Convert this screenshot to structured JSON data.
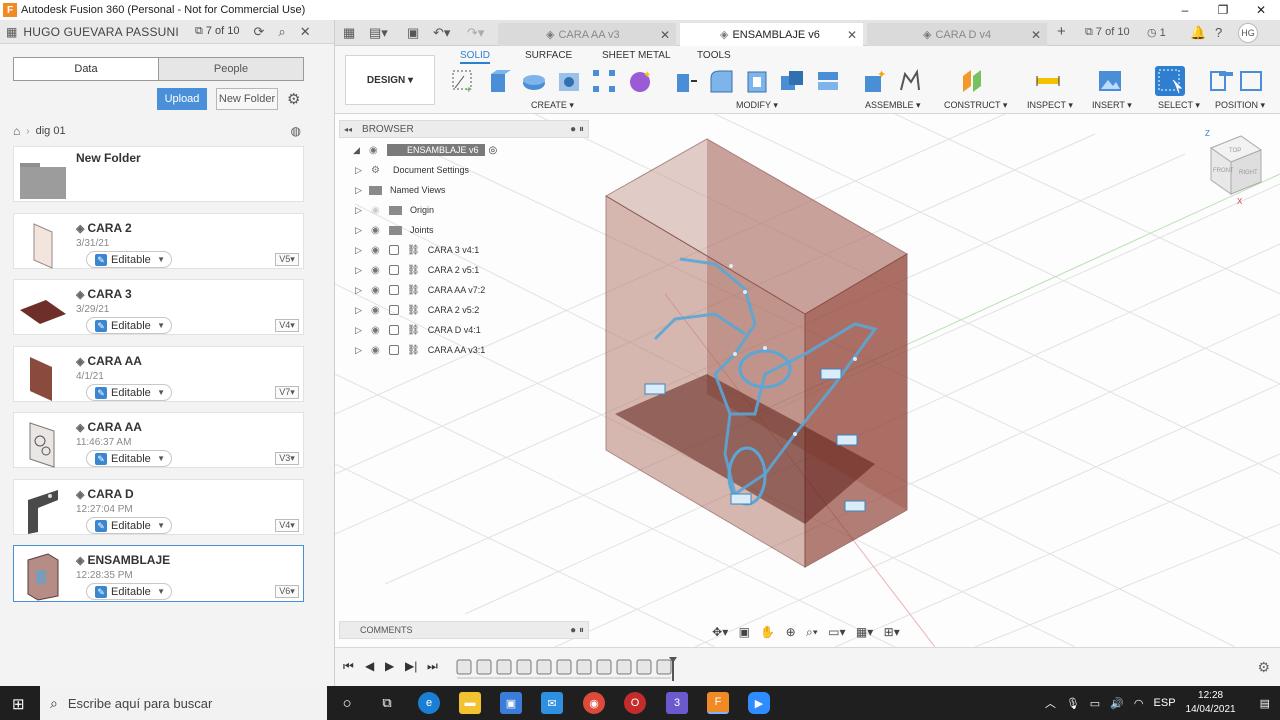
{
  "window": {
    "title": "Autodesk Fusion 360 (Personal - Not for Commercial Use)",
    "app_icon": "F",
    "minimize": "–",
    "maximize": "❐",
    "close": "✕"
  },
  "data_panel": {
    "user": "HUGO GUEVARA PASSUNI",
    "counter": "7 of 10",
    "tabs": {
      "data": "Data",
      "people": "People"
    },
    "upload_label": "Upload",
    "new_folder_label": "New Folder",
    "breadcrumb": "dig 01",
    "folder": {
      "name": "New Folder"
    },
    "files": [
      {
        "name": "CARA 2",
        "date": "3/31/21",
        "status": "Editable",
        "version": "V5"
      },
      {
        "name": "CARA 3",
        "date": "3/29/21",
        "status": "Editable",
        "version": "V4"
      },
      {
        "name": "CARA AA",
        "date": "4/1/21",
        "status": "Editable",
        "version": "V7"
      },
      {
        "name": "CARA AA",
        "date": "11:46:37 AM",
        "status": "Editable",
        "version": "V3"
      },
      {
        "name": "CARA D",
        "date": "12:27:04 PM",
        "status": "Editable",
        "version": "V4"
      },
      {
        "name": "ENSAMBLAJE",
        "date": "12:28:35 PM",
        "status": "Editable",
        "version": "V6"
      }
    ]
  },
  "doc_tabs": [
    {
      "label": "CARA  AA v3"
    },
    {
      "label": "ENSAMBLAJE v6"
    },
    {
      "label": "CARA D v4"
    }
  ],
  "top_right": {
    "counter": "7 of 10",
    "jobs": "1",
    "user_initials": "HG"
  },
  "toolbar": {
    "workspace": "DESIGN",
    "tabs": [
      "SOLID",
      "SURFACE",
      "SHEET METAL",
      "TOOLS"
    ],
    "groups": [
      "CREATE",
      "MODIFY",
      "ASSEMBLE",
      "CONSTRUCT",
      "INSPECT",
      "INSERT",
      "SELECT",
      "POSITION"
    ]
  },
  "browser": {
    "title": "BROWSER",
    "root": "ENSAMBLAJE v6",
    "items": [
      {
        "label": "Document Settings"
      },
      {
        "label": "Named Views"
      },
      {
        "label": "Origin"
      },
      {
        "label": "Joints"
      },
      {
        "label": "CARA 3 v4:1"
      },
      {
        "label": "CARA 2 v5:1"
      },
      {
        "label": "CARA  AA v7:2"
      },
      {
        "label": "CARA 2 v5:2"
      },
      {
        "label": "CARA D v4:1"
      },
      {
        "label": "CARA  AA v3:1"
      }
    ]
  },
  "comments": {
    "title": "COMMENTS"
  },
  "viewcube": {
    "top": "TOP",
    "front": "FRONT",
    "right": "RIGHT",
    "z": "Z",
    "x": "X"
  },
  "taskbar": {
    "search_placeholder": "Escribe aquí para buscar",
    "language": "ESP",
    "time": "12:28",
    "date": "14/04/2021",
    "mail_badge": "3"
  },
  "colors": {
    "accent": "#4a90d9",
    "model": "#8b3a2e",
    "sketch": "#5aa6d6"
  }
}
